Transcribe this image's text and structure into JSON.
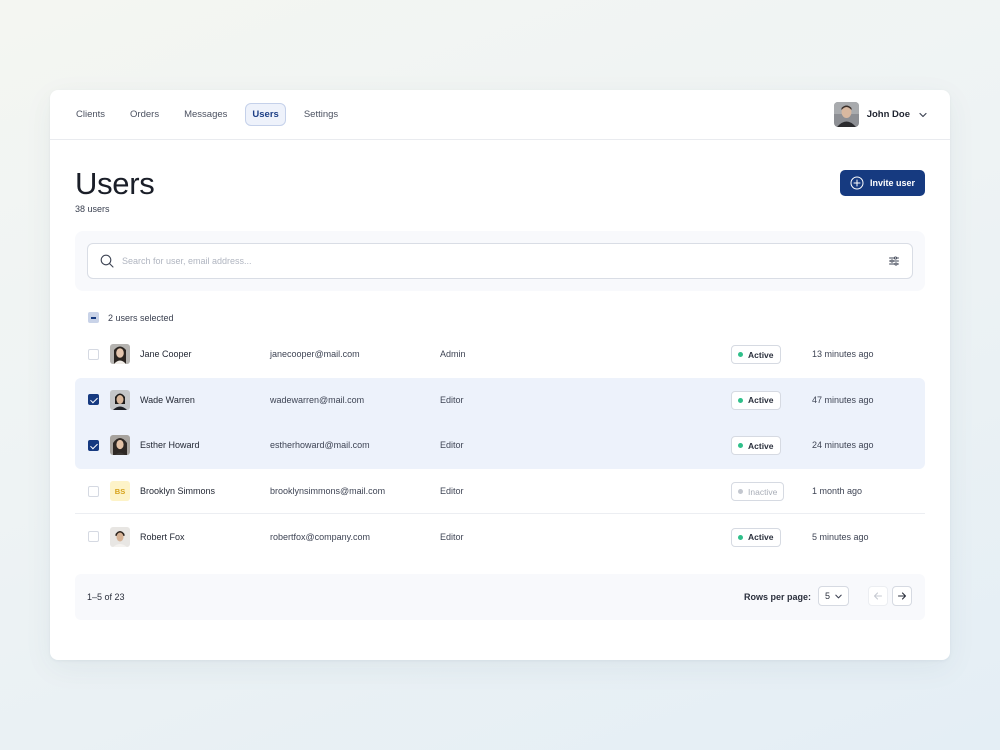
{
  "nav": {
    "tabs": [
      {
        "label": "Clients"
      },
      {
        "label": "Orders"
      },
      {
        "label": "Messages"
      },
      {
        "label": "Users",
        "active": true
      },
      {
        "label": "Settings"
      }
    ],
    "user_name": "John Doe"
  },
  "header": {
    "title": "Users",
    "subtitle": "38 users",
    "invite_label": "Invite user"
  },
  "search": {
    "placeholder": "Search for user, email address...",
    "value": ""
  },
  "selection": {
    "label": "2 users selected"
  },
  "users": [
    {
      "name": "Jane Cooper",
      "email": "janecooper@mail.com",
      "role": "Admin",
      "status": "Active",
      "last_active": "13 minutes ago",
      "selected": false,
      "avatar": "photo"
    },
    {
      "name": "Wade Warren",
      "email": "wadewarren@mail.com",
      "role": "Editor",
      "status": "Active",
      "last_active": "47 minutes ago",
      "selected": true,
      "avatar": "photo"
    },
    {
      "name": "Esther Howard",
      "email": "estherhoward@mail.com",
      "role": "Editor",
      "status": "Active",
      "last_active": "24 minutes ago",
      "selected": true,
      "avatar": "photo"
    },
    {
      "name": "Brooklyn Simmons",
      "email": "brooklynsimmons@mail.com",
      "role": "Editor",
      "status": "Inactive",
      "last_active": "1 month ago",
      "selected": false,
      "avatar": "initials",
      "initials": "BS"
    },
    {
      "name": "Robert Fox",
      "email": "robertfox@company.com",
      "role": "Editor",
      "status": "Active",
      "last_active": "5 minutes ago",
      "selected": false,
      "avatar": "photo"
    }
  ],
  "pagination": {
    "range": "1–5 of 23",
    "rows_per_page_label": "Rows per page:",
    "rows_per_page_value": "5"
  },
  "colors": {
    "accent": "#163a80",
    "active_dot": "#2fbf8a",
    "selected_row": "#edf2fb"
  },
  "icons": {
    "search": "search-icon",
    "filter": "sliders-icon",
    "invite": "plus-circle-icon",
    "chevron": "chevron-down-icon",
    "prev": "arrow-left-icon",
    "next": "arrow-right-icon"
  }
}
